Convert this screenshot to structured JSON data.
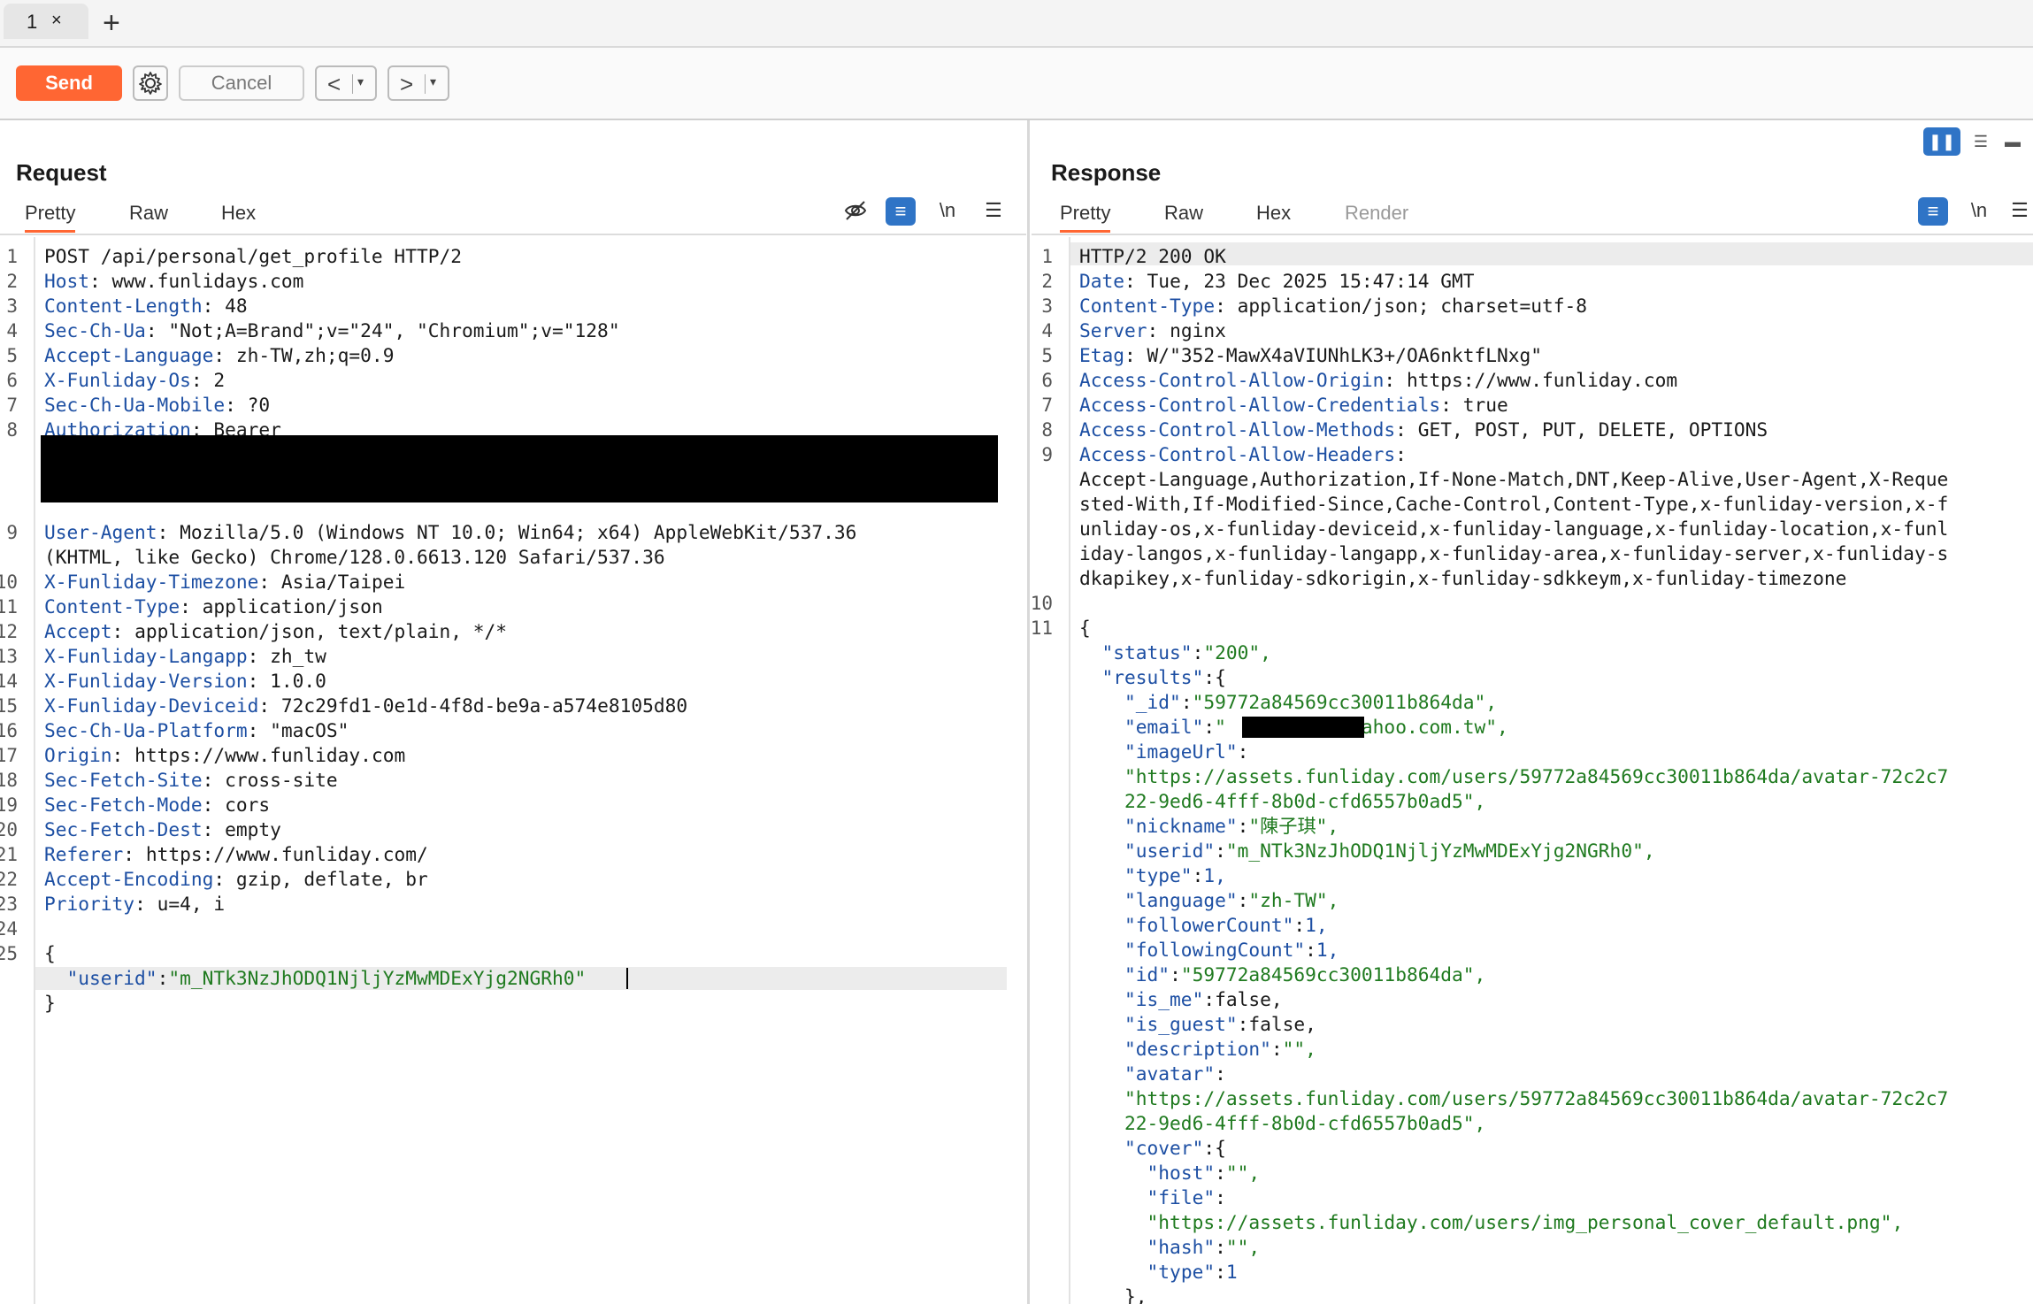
{
  "tab": {
    "label": "1",
    "close": "×",
    "new": "+"
  },
  "toolbar": {
    "send": "Send",
    "cancel": "Cancel",
    "back": "<",
    "forward": ">",
    "dropdown": "▾"
  },
  "request": {
    "title": "Request",
    "tabs": [
      "Pretty",
      "Raw",
      "Hex"
    ],
    "newline_label": "\\n",
    "lines": [
      {
        "n": "1",
        "text": "POST /api/personal/get_profile HTTP/2"
      },
      {
        "n": "2",
        "key": "Host",
        "value": " www.funlidays.com"
      },
      {
        "n": "3",
        "key": "Content-Length",
        "value": " 48"
      },
      {
        "n": "4",
        "key": "Sec-Ch-Ua",
        "value": " \"Not;A=Brand\";v=\"24\", \"Chromium\";v=\"128\""
      },
      {
        "n": "5",
        "key": "Accept-Language",
        "value": " zh-TW,zh;q=0.9"
      },
      {
        "n": "6",
        "key": "X-Funliday-Os",
        "value": " 2"
      },
      {
        "n": "7",
        "key": "Sec-Ch-Ua-Mobile",
        "value": " ?0"
      },
      {
        "n": "8",
        "key": "Authorization",
        "value": " Bearer"
      },
      {
        "n": "9",
        "key": "User-Agent",
        "value": " Mozilla/5.0 (Windows NT 10.0; Win64; x64) AppleWebKit/537.36"
      },
      {
        "n": "",
        "text": "(KHTML, like Gecko) Chrome/128.0.6613.120 Safari/537.36"
      },
      {
        "n": "10",
        "key": "X-Funliday-Timezone",
        "value": " Asia/Taipei"
      },
      {
        "n": "11",
        "key": "Content-Type",
        "value": " application/json"
      },
      {
        "n": "12",
        "key": "Accept",
        "value": " application/json, text/plain, */*"
      },
      {
        "n": "13",
        "key": "X-Funliday-Langapp",
        "value": " zh_tw"
      },
      {
        "n": "14",
        "key": "X-Funliday-Version",
        "value": " 1.0.0"
      },
      {
        "n": "15",
        "key": "X-Funliday-Deviceid",
        "value": " 72c29fd1-0e1d-4f8d-be9a-a574e8105d80"
      },
      {
        "n": "16",
        "key": "Sec-Ch-Ua-Platform",
        "value": " \"macOS\""
      },
      {
        "n": "17",
        "key": "Origin",
        "value": " https://www.funliday.com"
      },
      {
        "n": "18",
        "key": "Sec-Fetch-Site",
        "value": " cross-site"
      },
      {
        "n": "19",
        "key": "Sec-Fetch-Mode",
        "value": " cors"
      },
      {
        "n": "20",
        "key": "Sec-Fetch-Dest",
        "value": " empty"
      },
      {
        "n": "21",
        "key": "Referer",
        "value": " https://www.funliday.com/"
      },
      {
        "n": "22",
        "key": "Accept-Encoding",
        "value": " gzip, deflate, br"
      },
      {
        "n": "23",
        "key": "Priority",
        "value": " u=4, i"
      },
      {
        "n": "24",
        "text": ""
      },
      {
        "n": "25",
        "text": "{"
      },
      {
        "n": "",
        "indent": 1,
        "jkey": "\"userid\"",
        "jval": "\"m_NTk3NzJhODQ1NjljYzMwMDExYjg2NGRh0\""
      },
      {
        "n": "",
        "text": "}"
      }
    ]
  },
  "response": {
    "title": "Response",
    "tabs": [
      "Pretty",
      "Raw",
      "Hex",
      "Render"
    ],
    "newline_label": "\\n",
    "lines": [
      {
        "n": "1",
        "text": "HTTP/2 200 OK"
      },
      {
        "n": "2",
        "key": "Date",
        "value": " Tue, 23 Dec 2025 15:47:14 GMT"
      },
      {
        "n": "3",
        "key": "Content-Type",
        "value": " application/json; charset=utf-8"
      },
      {
        "n": "4",
        "key": "Server",
        "value": " nginx"
      },
      {
        "n": "5",
        "key": "Etag",
        "value": " W/\"352-MawX4aVIUNhLK3+/OA6nktfLNxg\""
      },
      {
        "n": "6",
        "key": "Access-Control-Allow-Origin",
        "value": " https://www.funliday.com"
      },
      {
        "n": "7",
        "key": "Access-Control-Allow-Credentials",
        "value": " true"
      },
      {
        "n": "8",
        "key": "Access-Control-Allow-Methods",
        "value": " GET, POST, PUT, DELETE, OPTIONS"
      },
      {
        "n": "9",
        "key": "Access-Control-Allow-Headers",
        "value": ""
      },
      {
        "n": "",
        "text": "Accept-Language,Authorization,If-None-Match,DNT,Keep-Alive,User-Agent,X-Reque"
      },
      {
        "n": "",
        "text": "sted-With,If-Modified-Since,Cache-Control,Content-Type,x-funliday-version,x-f"
      },
      {
        "n": "",
        "text": "unliday-os,x-funliday-deviceid,x-funliday-language,x-funliday-location,x-funl"
      },
      {
        "n": "",
        "text": "iday-langos,x-funliday-langapp,x-funliday-area,x-funliday-server,x-funliday-s"
      },
      {
        "n": "",
        "text": "dkapikey,x-funliday-sdkorigin,x-funliday-sdkkeym,x-funliday-timezone"
      },
      {
        "n": "10",
        "text": ""
      },
      {
        "n": "11",
        "text": "{"
      },
      {
        "n": "",
        "indent": 1,
        "jkey": "\"status\"",
        "jval": "\"200\","
      },
      {
        "n": "",
        "indent": 1,
        "jkey": "\"results\"",
        "jraw": "{"
      },
      {
        "n": "",
        "indent": 2,
        "jkey": "\"_id\"",
        "jval": "\"59772a84569cc30011b864da\","
      },
      {
        "n": "",
        "indent": 2,
        "jkey": "\"email\"",
        "jval": "\"          @yahoo.com.tw\","
      },
      {
        "n": "",
        "indent": 2,
        "jkey": "\"imageUrl\"",
        "jraw": ""
      },
      {
        "n": "",
        "indent": 2,
        "jstr": "\"https://assets.funliday.com/users/59772a84569cc30011b864da/avatar-72c2c7"
      },
      {
        "n": "",
        "indent": 2,
        "jstr": "22-9ed6-4fff-8b0d-cfd6557b0ad5\","
      },
      {
        "n": "",
        "indent": 2,
        "jkey": "\"nickname\"",
        "jval": "\"陳子琪\","
      },
      {
        "n": "",
        "indent": 2,
        "jkey": "\"userid\"",
        "jval": "\"m_NTk3NzJhODQ1NjljYzMwMDExYjg2NGRh0\","
      },
      {
        "n": "",
        "indent": 2,
        "jkey": "\"type\"",
        "jnum": "1,"
      },
      {
        "n": "",
        "indent": 2,
        "jkey": "\"language\"",
        "jval": "\"zh-TW\","
      },
      {
        "n": "",
        "indent": 2,
        "jkey": "\"followerCount\"",
        "jnum": "1,"
      },
      {
        "n": "",
        "indent": 2,
        "jkey": "\"followingCount\"",
        "jnum": "1,"
      },
      {
        "n": "",
        "indent": 2,
        "jkey": "\"id\"",
        "jval": "\"59772a84569cc30011b864da\","
      },
      {
        "n": "",
        "indent": 2,
        "jkey": "\"is_me\"",
        "jraw": "false,"
      },
      {
        "n": "",
        "indent": 2,
        "jkey": "\"is_guest\"",
        "jraw": "false,"
      },
      {
        "n": "",
        "indent": 2,
        "jkey": "\"description\"",
        "jval": "\"\","
      },
      {
        "n": "",
        "indent": 2,
        "jkey": "\"avatar\"",
        "jraw": ""
      },
      {
        "n": "",
        "indent": 2,
        "jstr": "\"https://assets.funliday.com/users/59772a84569cc30011b864da/avatar-72c2c7"
      },
      {
        "n": "",
        "indent": 2,
        "jstr": "22-9ed6-4fff-8b0d-cfd6557b0ad5\","
      },
      {
        "n": "",
        "indent": 2,
        "jkey": "\"cover\"",
        "jraw": "{"
      },
      {
        "n": "",
        "indent": 3,
        "jkey": "\"host\"",
        "jval": "\"\","
      },
      {
        "n": "",
        "indent": 3,
        "jkey": "\"file\"",
        "jraw": ""
      },
      {
        "n": "",
        "indent": 3,
        "jstr": "\"https://assets.funliday.com/users/img_personal_cover_default.png\","
      },
      {
        "n": "",
        "indent": 3,
        "jkey": "\"hash\"",
        "jval": "\"\","
      },
      {
        "n": "",
        "indent": 3,
        "jkey": "\"type\"",
        "jnum": "1"
      },
      {
        "n": "",
        "indent": 2,
        "text": "},"
      }
    ]
  },
  "colors": {
    "accent": "#ff6633",
    "blue": "#2f74c6",
    "header_key": "#1d4fa3",
    "json_string": "#1f7a1f"
  }
}
